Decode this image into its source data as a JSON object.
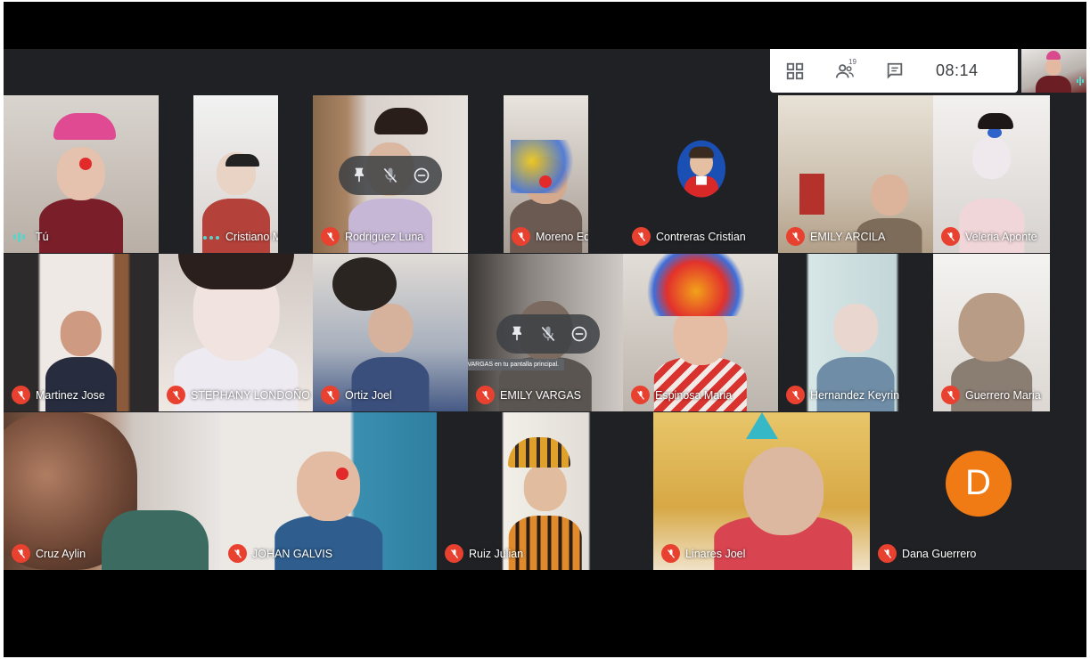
{
  "toolbar": {
    "icons": [
      "grid-layout-icon",
      "people-icon",
      "chat-icon"
    ],
    "participant_count": "19",
    "clock": "08:14"
  },
  "tooltip": "Fija a EMILY VARGAS en tu pantalla principal.",
  "tiles": [
    {
      "name": "Tú",
      "status": "speaking"
    },
    {
      "name": "Cristiano Matias",
      "status": "dots"
    },
    {
      "name": "Rodriguez Luna",
      "status": "muted"
    },
    {
      "name": "Moreno Edwin",
      "status": "muted"
    },
    {
      "name": "Contreras Cristian",
      "status": "muted"
    },
    {
      "name": "EMILY ARCILA",
      "status": "muted"
    },
    {
      "name": "Veleria Aponte",
      "status": "muted"
    },
    {
      "name": "Martinez Jose",
      "status": "muted"
    },
    {
      "name": "STEPHANY LONDOÑO",
      "status": "muted"
    },
    {
      "name": "Ortiz Joel",
      "status": "muted"
    },
    {
      "name": "EMILY VARGAS",
      "status": "muted"
    },
    {
      "name": "Espinosa Maria",
      "status": "muted"
    },
    {
      "name": "Hernandez Keyrin",
      "status": "muted"
    },
    {
      "name": "Guerrero Maria",
      "status": "muted"
    },
    {
      "name": "Cruz Aylin",
      "status": "muted"
    },
    {
      "name": "JOHAN GALVIS",
      "status": "muted"
    },
    {
      "name": "Ruiz Julian",
      "status": "muted"
    },
    {
      "name": "Linares Joel",
      "status": "muted"
    },
    {
      "name": "Dana Guerrero",
      "status": "muted",
      "avatar_letter": "D",
      "avatar_color": "#f07a14"
    }
  ],
  "colors": {
    "muted_badge": "#e8412f",
    "speaking": "#5ad3c9",
    "stage_bg": "#202124"
  }
}
